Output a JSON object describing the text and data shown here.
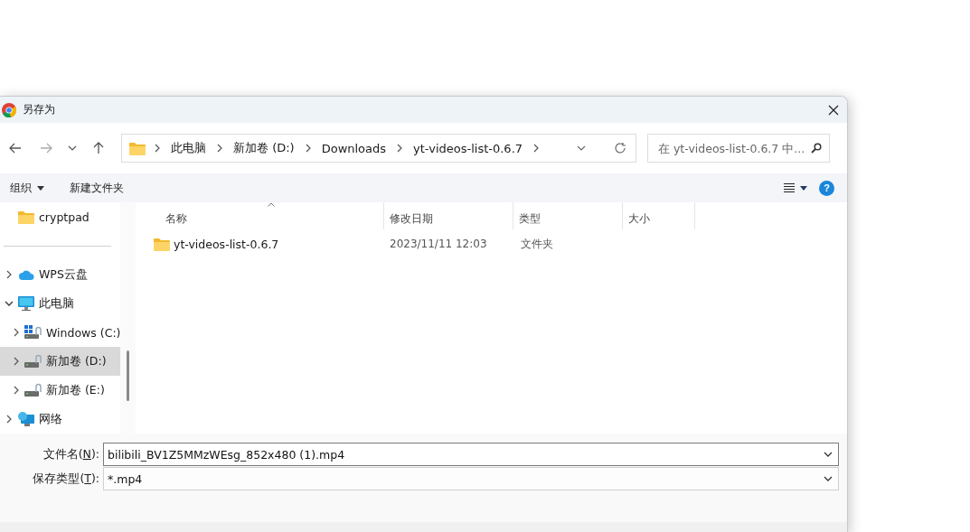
{
  "window": {
    "title": "另存为"
  },
  "breadcrumbs": [
    "此电脑",
    "新加卷 (D:)",
    "Downloads",
    "yt-videos-list-0.6.7"
  ],
  "search": {
    "placeholder": "在 yt-videos-list-0.6.7 中..."
  },
  "toolbar": {
    "organize": "组织",
    "new_folder": "新建文件夹",
    "help": "?"
  },
  "sidebar": {
    "items": [
      {
        "label": "cryptpad",
        "kind": "folder",
        "selected": false
      },
      {
        "kind": "divider"
      },
      {
        "label": "WPS云盘",
        "kind": "cloud",
        "expanded": false,
        "selected": false
      },
      {
        "label": "此电脑",
        "kind": "computer",
        "expanded": true,
        "selected": false,
        "children": [
          {
            "label": "Windows (C:)",
            "kind": "system-drive",
            "expanded": false,
            "selected": false
          },
          {
            "label": "新加卷 (D:)",
            "kind": "drive",
            "expanded": false,
            "selected": true
          },
          {
            "label": "新加卷 (E:)",
            "kind": "drive",
            "expanded": false,
            "selected": false
          }
        ]
      },
      {
        "label": "网络",
        "kind": "network",
        "expanded": false,
        "selected": false
      }
    ]
  },
  "table": {
    "columns": [
      {
        "label": "名称",
        "sorted": true
      },
      {
        "label": "修改日期",
        "sorted": false
      },
      {
        "label": "类型",
        "sorted": false
      },
      {
        "label": "大小",
        "sorted": false
      }
    ],
    "rows": [
      {
        "name": "yt-videos-list-0.6.7",
        "modified": "2023/11/11 12:03",
        "type": "文件夹"
      }
    ]
  },
  "fields": [
    {
      "label": {
        "before": "文件名(",
        "access_key": "N",
        "after": "):"
      },
      "value": "bilibili_BV1Z5MMzWEsg_852x480 (1).mp4",
      "focused": true
    },
    {
      "label": {
        "before": "保存类型(",
        "access_key": "T",
        "after": "):"
      },
      "value": "*.mp4",
      "focused": false
    }
  ]
}
